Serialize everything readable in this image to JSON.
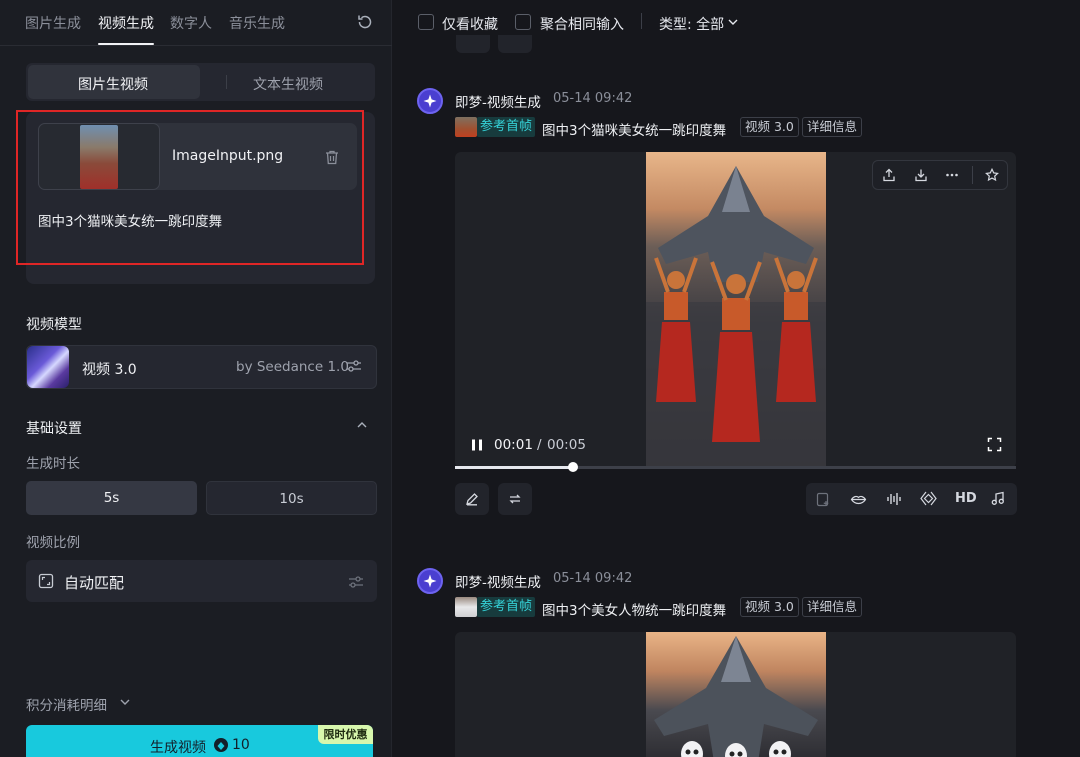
{
  "left_panel": {
    "tabs": [
      "图片生成",
      "视频生成",
      "数字人",
      "音乐生成"
    ],
    "mode_tabs": [
      "图片生视频",
      "文本生视频"
    ],
    "upload": {
      "filename": "ImageInput.png",
      "prompt": "图中3个猫咪美女统一跳印度舞"
    },
    "model_section_title": "视频模型",
    "model": {
      "name": "视频 3.0",
      "by": "by Seedance 1.0"
    },
    "basic_settings_title": "基础设置",
    "duration_label": "生成时长",
    "durations": [
      "5s",
      "10s"
    ],
    "ratio_label": "视频比例",
    "ratio_value": "自动匹配",
    "points_label": "积分消耗明细",
    "generate_label": "生成视频",
    "generate_cost": "10",
    "promo_badge": "限时优惠"
  },
  "right_panel": {
    "filters": {
      "favorites_only": "仅看收藏",
      "merge_same_input": "聚合相同输入",
      "type_label": "类型: 全部"
    },
    "entries": [
      {
        "author": "即梦-视频生成",
        "time": "05-14  09:42",
        "ref_tag": "参考首帧",
        "prompt": "图中3个猫咪美女统一跳印度舞",
        "model_tag": "视频 3.0",
        "detail_tag": "详细信息",
        "current_time": "00:01",
        "time_sep": "/",
        "duration": "00:05",
        "progress": 0.21,
        "quality_label": "HD"
      },
      {
        "author": "即梦-视频生成",
        "time": "05-14  09:42",
        "ref_tag": "参考首帧",
        "prompt": "图中3个美女人物统一跳印度舞",
        "model_tag": "视频 3.0",
        "detail_tag": "详细信息"
      }
    ]
  },
  "icons": [
    "refresh-icon",
    "trash-icon",
    "sliders-icon",
    "aspect-ratio-icon",
    "chevron-up-icon",
    "chevron-down-icon",
    "star-icon",
    "share-icon",
    "download-icon",
    "more-icon",
    "pause-icon",
    "fullscreen-icon",
    "edit-icon",
    "regenerate-icon",
    "lip-sync-icon",
    "audio-icon",
    "music-icon"
  ],
  "colors": {
    "accent": "#18c9dd",
    "promo": "#d8f7ad",
    "highlight_box": "#e02626",
    "ref_tag": "#35d2d8"
  }
}
